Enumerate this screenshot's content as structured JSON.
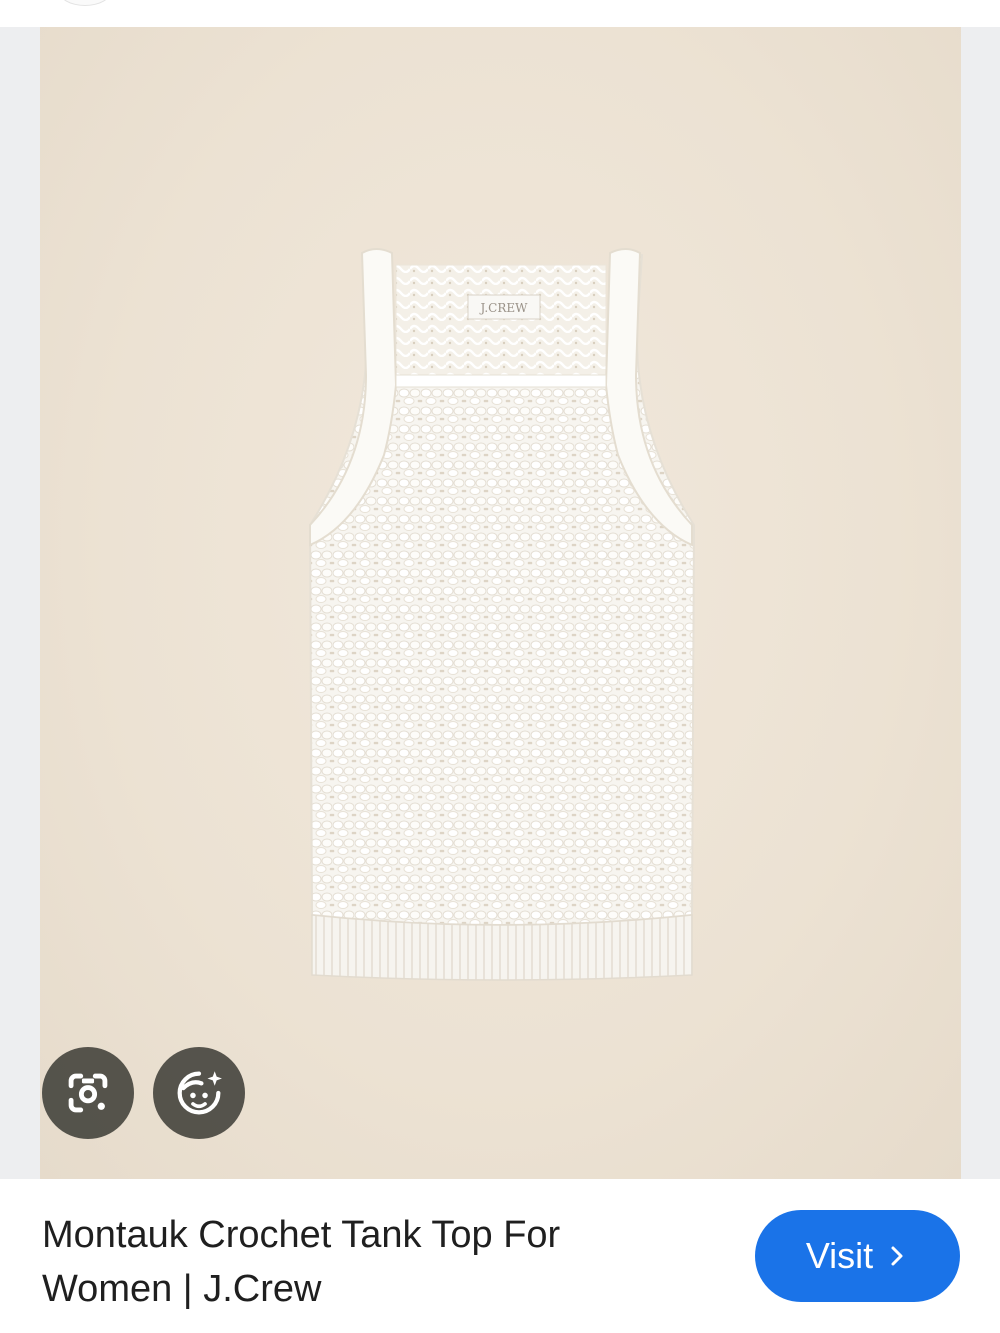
{
  "product": {
    "image_label": "J.CREW",
    "title_line1": "Montauk Crochet Tank Top For",
    "title_line2": "Women | J.Crew"
  },
  "actions": {
    "visit_label": "Visit",
    "lens_icon": "google-lens-icon",
    "style_icon": "ai-style-icon"
  },
  "colors": {
    "visit_button": "#1a73e8",
    "image_background": "#ece2d3",
    "overlay_buttons": "#484640"
  }
}
